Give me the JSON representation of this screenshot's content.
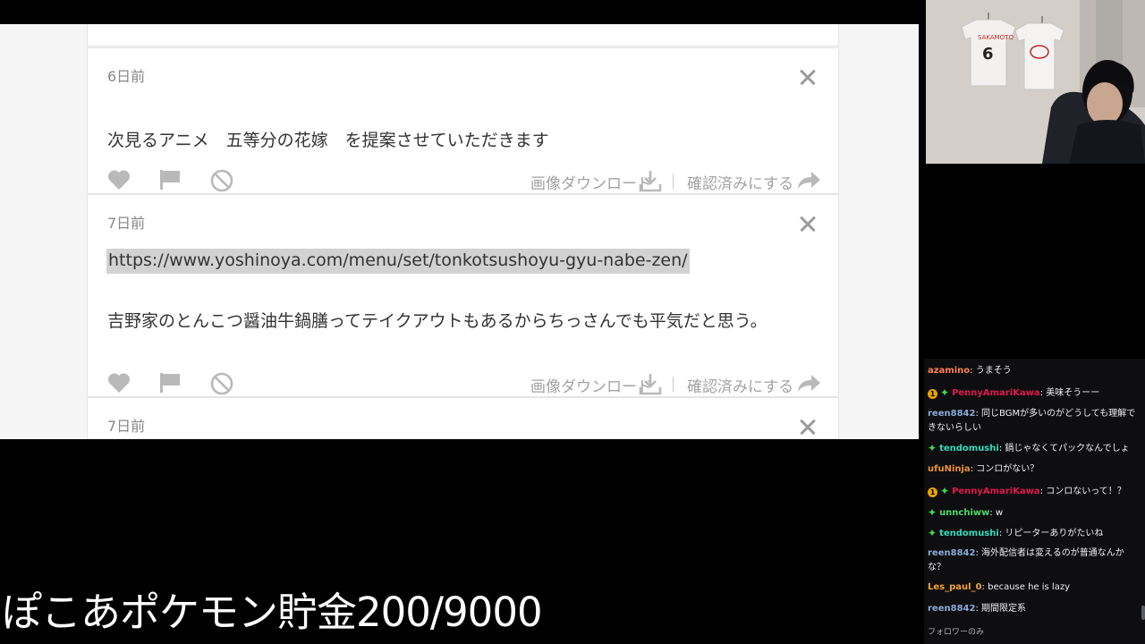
{
  "browser": {
    "cards": [
      {
        "time": "6日前",
        "message": "次見るアニメ　五等分の花嫁　を提案させていただきます",
        "download_label": "画像ダウンロード",
        "confirm_label": "確認済みにする"
      },
      {
        "time": "7日前",
        "link": "https://www.yoshinoya.com/menu/set/tonkotsushoyu-gyu-nabe-zen/",
        "message": "吉野家のとんこつ醤油牛鍋膳ってテイクアウトもあるからちっさんでも平気だと思う。",
        "download_label": "画像ダウンロード",
        "confirm_label": "確認済みにする"
      },
      {
        "time": "7日前"
      }
    ]
  },
  "chat": {
    "messages": [
      {
        "user": "azamino",
        "color": "#ff7f50",
        "text": "うまそう"
      },
      {
        "user": "PennyAmariKawa",
        "color": "#e0184c",
        "text": "美味そうーー",
        "badge": "1"
      },
      {
        "user": "reen8842",
        "color": "#8aa9d6",
        "text": "同じBGMが多いのがどうしても理解できないらしい"
      },
      {
        "user": "tendomushi",
        "color": "#2fdcc0",
        "text": "鍋じゃなくてパックなんでしょ"
      },
      {
        "user": "ufuNinja",
        "color": "#e9922e",
        "text": "コンロがない？"
      },
      {
        "user": "PennyAmariKawa",
        "color": "#e0184c",
        "text": "コンロないって！？",
        "badge": "1"
      },
      {
        "user": "unnchiww",
        "color": "#4ad96a",
        "text": "w"
      },
      {
        "user": "tendomushi",
        "color": "#2fdcc0",
        "text": "リピーターありがたいね"
      },
      {
        "user": "reen8842",
        "color": "#8aa9d6",
        "text": "海外配信者は変えるのが普通なんかな？"
      },
      {
        "user": "Les_paul_0",
        "color": "#f2a23a",
        "text": "because he is lazy"
      },
      {
        "user": "reen8842",
        "color": "#8aa9d6",
        "text": "期間限定系"
      }
    ],
    "footer": "フォロワーのみ"
  },
  "overlay": {
    "text": "ぽこあポケモン貯金200/9000"
  },
  "colors": {
    "accent_text": "#333333",
    "muted": "#a3a3a3",
    "chat_bg": "#0e0e10"
  }
}
